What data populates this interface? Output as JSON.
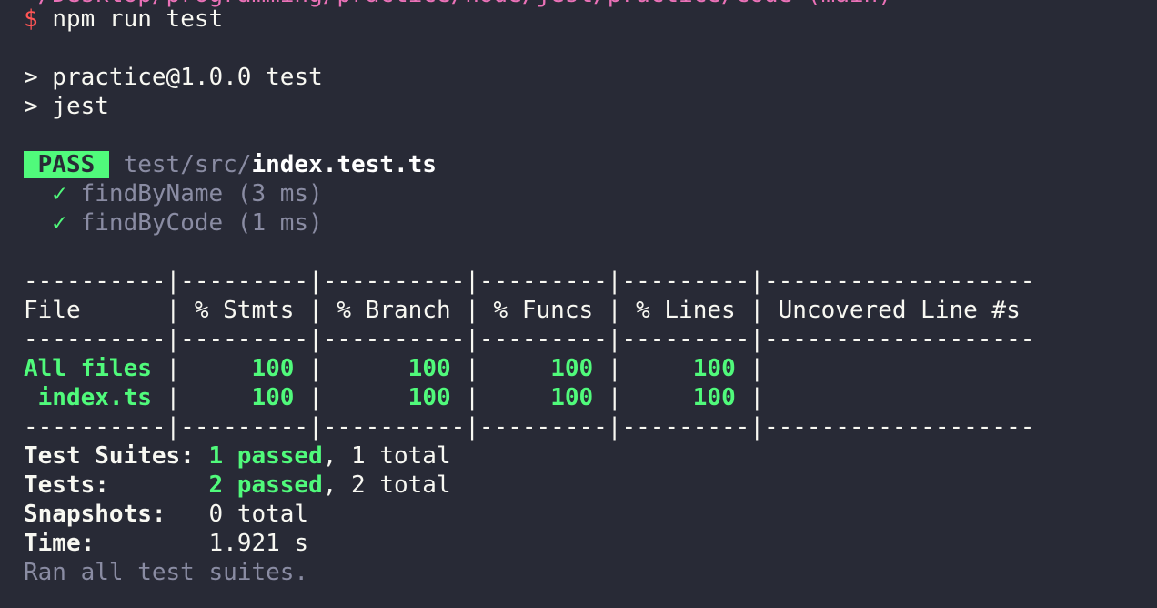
{
  "terminal": {
    "cut_top_text": "~/Desktop/programming/practice/node/jest/practice/code (main)",
    "prompt_symbol": "$",
    "command": "npm run test",
    "npm_script_header": "> practice@1.0.0 test",
    "npm_script_cmd": "> jest",
    "result": {
      "badge": " PASS ",
      "file_dir": "test/src/",
      "file_name": "index.test.ts",
      "tests": [
        {
          "check": "✓",
          "label": "findByName (3 ms)"
        },
        {
          "check": "✓",
          "label": "findByCode (1 ms)"
        }
      ]
    },
    "coverage": {
      "separator": "----------|---------|----------|---------|---------|-------------------",
      "header_row": "File      | % Stmts | % Branch | % Funcs | % Lines | Uncovered Line #s ",
      "rows": [
        {
          "file": "All files",
          "file_cell": "All files ",
          "rest": "|     100 |      100 |     100 |     100 |                   ",
          "stmts": "100",
          "branch": "100",
          "funcs": "100",
          "lines": "100"
        },
        {
          "file": "index.ts",
          "file_cell": " index.ts ",
          "rest": "|     100 |      100 |     100 |     100 |                   ",
          "stmts": "100",
          "branch": "100",
          "funcs": "100",
          "lines": "100"
        }
      ]
    },
    "summary": {
      "suites_label": "Test Suites:",
      "suites_passed": "1 passed",
      "suites_total": ", 1 total",
      "tests_label": "Tests:",
      "tests_passed": "2 passed",
      "tests_total": ", 2 total",
      "snapshots_label": "Snapshots:",
      "snapshots_value": "0 total",
      "time_label": "Time:",
      "time_value": "1.921 s",
      "footer": "Ran all test suites."
    }
  }
}
